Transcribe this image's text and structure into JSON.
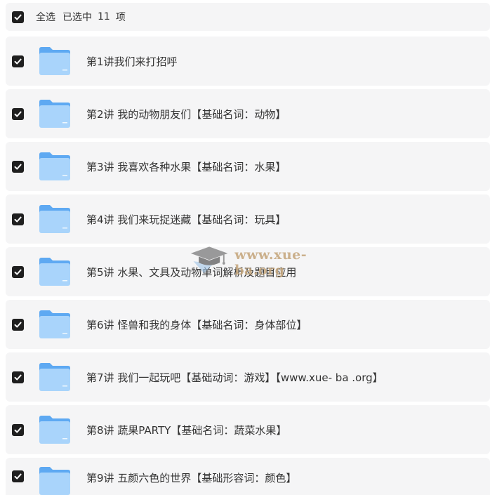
{
  "select_all": {
    "label": "全选",
    "selected_text": "已选中",
    "count": "11",
    "unit": "项"
  },
  "items": [
    {
      "name": "第1讲我们来打招呼"
    },
    {
      "name": "第2讲 我的动物朋友们【基础名词：动物】"
    },
    {
      "name": "第3讲 我喜欢各种水果【基础名词：水果】"
    },
    {
      "name": "第4讲 我们来玩捉迷藏【基础名词：玩具】"
    },
    {
      "name": "第5讲 水果、文具及动物单词解析及题目应用"
    },
    {
      "name": "第6讲 怪兽和我的身体【基础名词：身体部位】"
    },
    {
      "name": "第7讲 我们一起玩吧【基础动词：游戏】【www.xue- ba .org】"
    },
    {
      "name": "第8讲 蔬果PARTY【基础名词：蔬菜水果】"
    },
    {
      "name": "第9讲 五颜六色的世界【基础形容词：颜色】"
    }
  ],
  "watermark": {
    "text": "www.xue-ba.org",
    "icon": "graduation-cap-icon"
  },
  "colors": {
    "row_bg": "#f5f5f6",
    "checkbox": "#1f1f1f",
    "folder_light": "#a9d4fb",
    "folder_dark": "#5ea9f2",
    "watermark": "#c4a57a"
  }
}
